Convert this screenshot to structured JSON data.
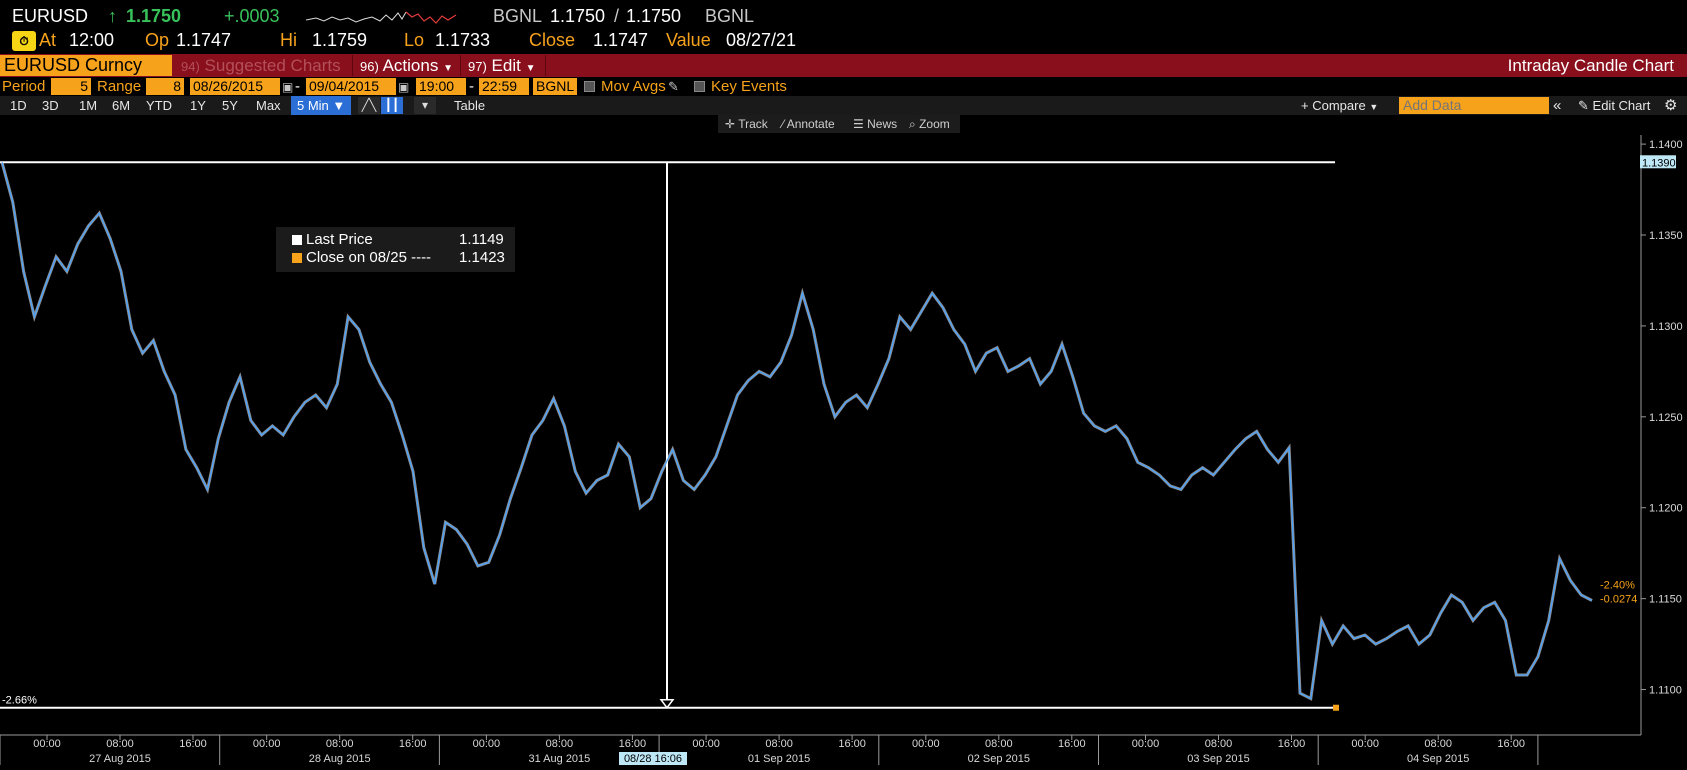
{
  "quote": {
    "ticker": "EURUSD",
    "last": "1.1750",
    "change": "+.0003",
    "source1": "BGNL",
    "bid": "1.1750",
    "ask": "1.1750",
    "source2": "BGNL",
    "at_label": "At",
    "at_value": "12:00",
    "op_label": "Op",
    "op_value": "1.1747",
    "hi_label": "Hi",
    "hi_value": "1.1759",
    "lo_label": "Lo",
    "lo_value": "1.1733",
    "close_label": "Close",
    "close_value": "1.1747",
    "value_label": "Value",
    "value_date": "08/27/21"
  },
  "command": {
    "security": "EURUSD Curncy",
    "suggested_num": "94)",
    "suggested": "Suggested Charts",
    "actions_num": "96)",
    "actions": "Actions",
    "edit_num": "97)",
    "edit": "Edit",
    "chart_title": "Intraday Candle Chart"
  },
  "period": {
    "period_label": "Period",
    "period_value": "5",
    "range_label": "Range",
    "range_value": "8",
    "start_date": "08/26/2015",
    "end_date": "09/04/2015",
    "start_time": "19:00",
    "end_time": "22:59",
    "source": "BGNL",
    "mov_avgs": "Mov Avgs",
    "key_events": "Key Events"
  },
  "toolbar": {
    "ranges": [
      "1D",
      "3D",
      "1M",
      "6M",
      "YTD",
      "1Y",
      "5Y",
      "Max"
    ],
    "selected": "5 Min",
    "table": "Table",
    "compare": "Compare",
    "add_data_placeholder": "Add Data",
    "edit_chart": "Edit Chart"
  },
  "float_tools": [
    "Track",
    "Annotate",
    "News",
    "Zoom"
  ],
  "legend": {
    "item1_label": "Last Price",
    "item1_value": "1.1149",
    "item2_label": "Close on 08/25 ----",
    "item2_value": "1.1423"
  },
  "colors": {
    "amber": "#f7a21b",
    "red_bar": "#8a0f1d",
    "price_line": "#4aa3ff",
    "price_wick": "#ffffff",
    "up_green": "#38c25a",
    "selected_blue": "#2a6ed6"
  },
  "chart_data": {
    "type": "line",
    "series": [
      {
        "name": "Last Price",
        "values": [
          1.139,
          1.1368,
          1.133,
          1.1305,
          1.1322,
          1.1338,
          1.133,
          1.1345,
          1.1355,
          1.1362,
          1.1348,
          1.133,
          1.1298,
          1.1285,
          1.1292,
          1.1275,
          1.1262,
          1.1232,
          1.1222,
          1.121,
          1.1238,
          1.1258,
          1.1272,
          1.1248,
          1.124,
          1.1245,
          1.124,
          1.125,
          1.1258,
          1.1262,
          1.1255,
          1.1268,
          1.1305,
          1.1298,
          1.128,
          1.1268,
          1.1258,
          1.124,
          1.122,
          1.1178,
          1.1158,
          1.1192,
          1.1188,
          1.118,
          1.1168,
          1.117,
          1.1185,
          1.1205,
          1.1222,
          1.124,
          1.1248,
          1.126,
          1.1245,
          1.122,
          1.1208,
          1.1215,
          1.1218,
          1.1235,
          1.1228,
          1.12,
          1.1205,
          1.122,
          1.1232,
          1.1215,
          1.121,
          1.1218,
          1.1228,
          1.1245,
          1.1262,
          1.127,
          1.1275,
          1.1272,
          1.128,
          1.1295,
          1.1318,
          1.1298,
          1.1268,
          1.125,
          1.1258,
          1.1262,
          1.1255,
          1.1268,
          1.1282,
          1.1305,
          1.1298,
          1.1308,
          1.1318,
          1.131,
          1.1298,
          1.129,
          1.1275,
          1.1285,
          1.1288,
          1.1275,
          1.1278,
          1.1282,
          1.1268,
          1.1275,
          1.129,
          1.1272,
          1.1252,
          1.1245,
          1.1242,
          1.1245,
          1.1238,
          1.1225,
          1.1222,
          1.1218,
          1.1212,
          1.121,
          1.1218,
          1.1222,
          1.1218,
          1.1225,
          1.1232,
          1.1238,
          1.1242,
          1.1232,
          1.1225,
          1.1233,
          1.1098,
          1.1095,
          1.1138,
          1.1125,
          1.1135,
          1.1128,
          1.113,
          1.1125,
          1.1128,
          1.1132,
          1.1135,
          1.1125,
          1.113,
          1.1142,
          1.1152,
          1.1148,
          1.1138,
          1.1145,
          1.1148,
          1.1138,
          1.1108,
          1.1108,
          1.1118,
          1.1138,
          1.1172,
          1.116,
          1.1152,
          1.1149
        ]
      }
    ],
    "x_tick_labels": [
      "00:00",
      "08:00",
      "16:00",
      "00:00",
      "08:00",
      "16:00",
      "00:00",
      "08:00",
      "16:00",
      "00:00",
      "08:00",
      "16:00",
      "00:00",
      "08:00",
      "16:00",
      "00:00",
      "08:00",
      "16:00",
      "00:00",
      "08:00",
      "16:00"
    ],
    "x_day_labels": [
      "27 Aug 2015",
      "28 Aug 2015",
      "31 Aug 2015",
      "01 Sep 2015",
      "02 Sep 2015",
      "03 Sep 2015",
      "04 Sep 2015"
    ],
    "crosshair_label": "08/28 16:06",
    "y_ticks": [
      "1.1400",
      "1.1350",
      "1.1300",
      "1.1250",
      "1.1200",
      "1.1150",
      "1.1100"
    ],
    "ylim": [
      1.1075,
      1.1405
    ],
    "high_line": 1.139,
    "high_label": "1.1390",
    "low_line": 1.109,
    "low_pct_label": "-2.66%",
    "last_pct_label": "-2.40%",
    "last_chg_label": "-0.0274",
    "grid": false
  }
}
